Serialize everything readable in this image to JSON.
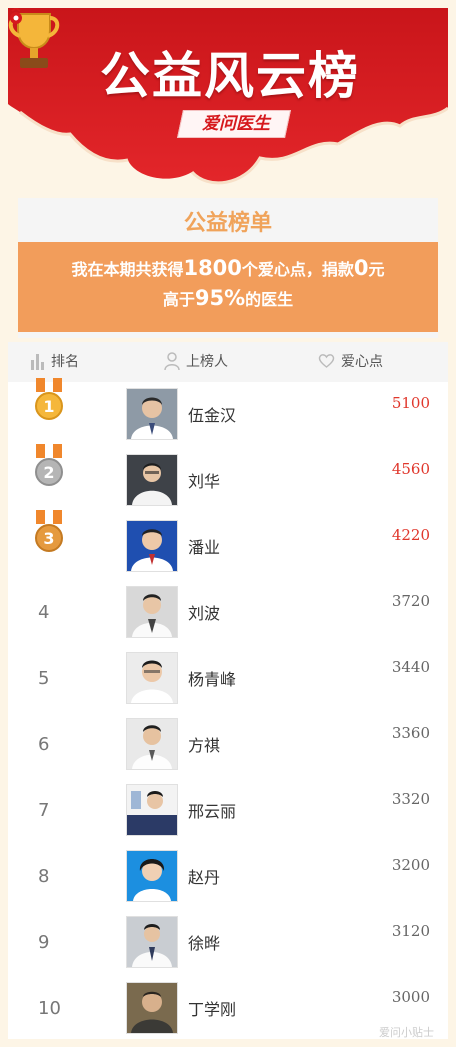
{
  "header": {
    "title": "公益风云榜",
    "brand": "爱问医生"
  },
  "summary": {
    "section_title": "公益榜单",
    "line1_prefix": "我在本期共获得",
    "points": "1800",
    "line1_mid": "个爱心点，捐款",
    "donation": "0",
    "line1_suffix": "元",
    "line2_prefix": "高于",
    "percent": "95%",
    "line2_suffix": "的医生"
  },
  "table": {
    "columns": {
      "rank": "排名",
      "doctor": "上榜人",
      "points": "爱心点"
    },
    "rows": [
      {
        "rank": "1",
        "name": "伍金汉",
        "score": "5100",
        "medal": "gold"
      },
      {
        "rank": "2",
        "name": "刘华",
        "score": "4560",
        "medal": "silver"
      },
      {
        "rank": "3",
        "name": "潘业",
        "score": "4220",
        "medal": "bronze"
      },
      {
        "rank": "4",
        "name": "刘波",
        "score": "3720"
      },
      {
        "rank": "5",
        "name": "杨青峰",
        "score": "3440"
      },
      {
        "rank": "6",
        "name": "方祺",
        "score": "3360"
      },
      {
        "rank": "7",
        "name": "邢云丽",
        "score": "3320"
      },
      {
        "rank": "8",
        "name": "赵丹",
        "score": "3200"
      },
      {
        "rank": "9",
        "name": "徐晔",
        "score": "3120"
      },
      {
        "rank": "10",
        "name": "丁学刚",
        "score": "3000"
      }
    ]
  },
  "watermark": "爱问小贴士",
  "colors": {
    "banner_red": "#d6191d",
    "accent_orange": "#f29d5b",
    "top_score": "#e0372c"
  }
}
